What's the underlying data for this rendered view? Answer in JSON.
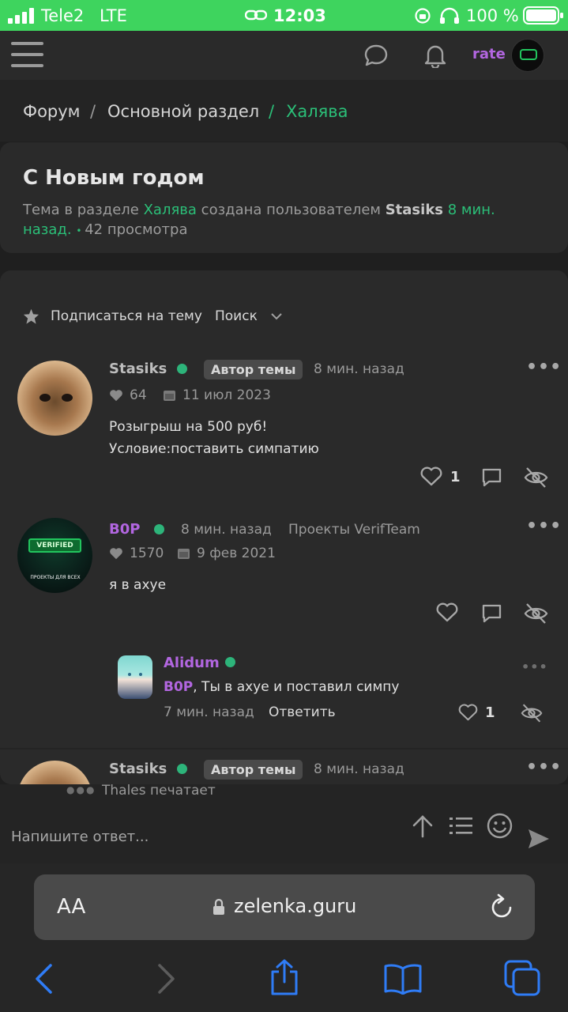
{
  "status_bar": {
    "carrier": "Tele2",
    "network": "LTE",
    "time": "12:03",
    "battery": "100 %"
  },
  "header": {
    "user_label": "rate",
    "icons": [
      "menu-icon",
      "chat-icon",
      "bell-icon"
    ]
  },
  "breadcrumb": {
    "items": [
      "Форум",
      "Основной раздел",
      "Халява"
    ],
    "separator": "/"
  },
  "topic": {
    "title": "С Новым годом",
    "meta_prefix": "Тема в разделе",
    "section": "Халява",
    "created_by": "создана пользователем",
    "author": "Stasiks",
    "time_line1": "8 мин.",
    "time_line2": "назад.",
    "views": "42 просмотра"
  },
  "toolbar": {
    "subscribe": "Подписаться на тему",
    "search": "Поиск"
  },
  "posts": [
    {
      "username": "Stasiks",
      "badge": "Автор темы",
      "time": "8 мин. назад",
      "likes": "64",
      "date": "11 июл 2023",
      "lines": [
        "Розыгрыш на 500 руб!",
        "Условие:поставить симпатию"
      ],
      "reaction_count": "1"
    },
    {
      "username": "B0P",
      "time": "8 мин. назад",
      "group": "Проекты VerifTeam",
      "likes": "1570",
      "date": "9 фев 2021",
      "lines": [
        "я в ахуе"
      ],
      "avatar_text": "VERIFIED",
      "avatar_caption": "ПРОЕКТЫ ДЛЯ ВСЕХ"
    },
    {
      "username": "Stasiks",
      "badge": "Автор темы",
      "time": "8 мин. назад"
    }
  ],
  "reply": {
    "username": "Alidum",
    "mention": "B0P",
    "text": ", Ты в ахуе и поставил симпу",
    "time": "7 мин. назад",
    "reply_label": "Ответить",
    "reaction_count": "1"
  },
  "typing": "Thales печатает",
  "composer": {
    "placeholder": "Напишите ответ..."
  },
  "browser": {
    "text_size": "AA",
    "url": "zelenka.guru"
  },
  "colors": {
    "accent_green": "#2bbf78",
    "username_purple": "#b266e0",
    "ios_blue": "#2f7cf6"
  }
}
